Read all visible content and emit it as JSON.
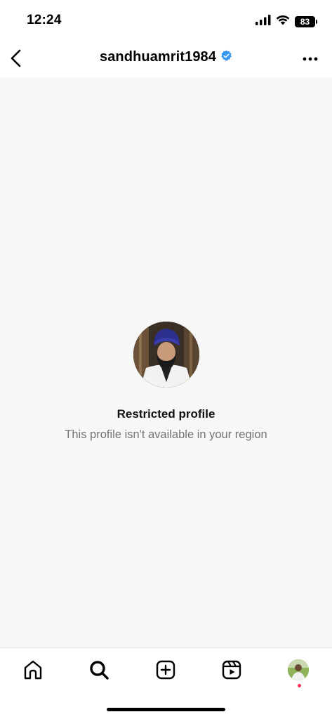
{
  "status_bar": {
    "time": "12:24",
    "battery": "83",
    "icons": [
      "signal-icon",
      "wifi-icon",
      "battery-icon"
    ]
  },
  "header": {
    "username": "sandhuamrit1984",
    "verified": true,
    "back_icon": "chevron-left-icon",
    "more_icon": "more-horizontal-icon",
    "verified_color": "#3897f0"
  },
  "main": {
    "title": "Restricted profile",
    "subtitle": "This profile isn't available in your region"
  },
  "bottom_nav": {
    "items": [
      "home-icon",
      "search-icon",
      "create-icon",
      "reels-icon",
      "profile-avatar"
    ],
    "active": "search-icon",
    "notification_dot_color": "#ff2d55"
  },
  "colors": {
    "background": "#f7f7f7",
    "subtitle": "#737373"
  }
}
